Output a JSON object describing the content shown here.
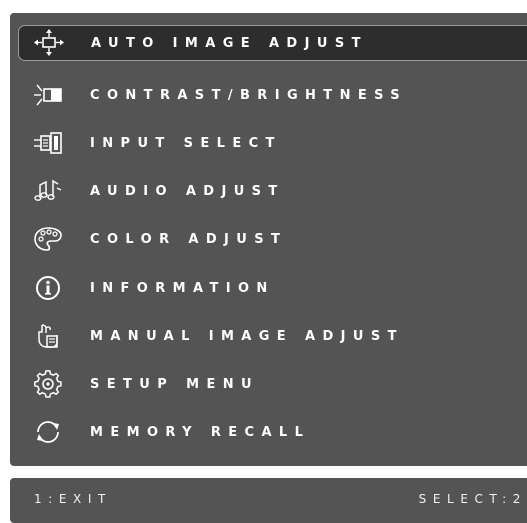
{
  "menu": {
    "items": [
      {
        "label": "AUTO IMAGE ADJUST",
        "icon": "auto-adjust-icon",
        "selected": true
      },
      {
        "label": "CONTRAST/BRIGHTNESS",
        "icon": "contrast-brightness-icon",
        "selected": false
      },
      {
        "label": "INPUT SELECT",
        "icon": "input-connector-icon",
        "selected": false
      },
      {
        "label": "AUDIO ADJUST",
        "icon": "music-note-icon",
        "selected": false
      },
      {
        "label": "COLOR ADJUST",
        "icon": "color-palette-icon",
        "selected": false
      },
      {
        "label": "INFORMATION",
        "icon": "info-icon",
        "selected": false
      },
      {
        "label": "MANUAL IMAGE ADJUST",
        "icon": "hand-adjust-icon",
        "selected": false
      },
      {
        "label": "SETUP MENU",
        "icon": "gear-icon",
        "selected": false
      },
      {
        "label": "MEMORY RECALL",
        "icon": "recall-arrows-icon",
        "selected": false
      }
    ]
  },
  "footer": {
    "exit_label": "1:EXIT",
    "select_label": "SELECT:2"
  },
  "colors": {
    "panel_background": "#545454",
    "selected_background": "#2d2d2d",
    "text": "#ffffff"
  }
}
